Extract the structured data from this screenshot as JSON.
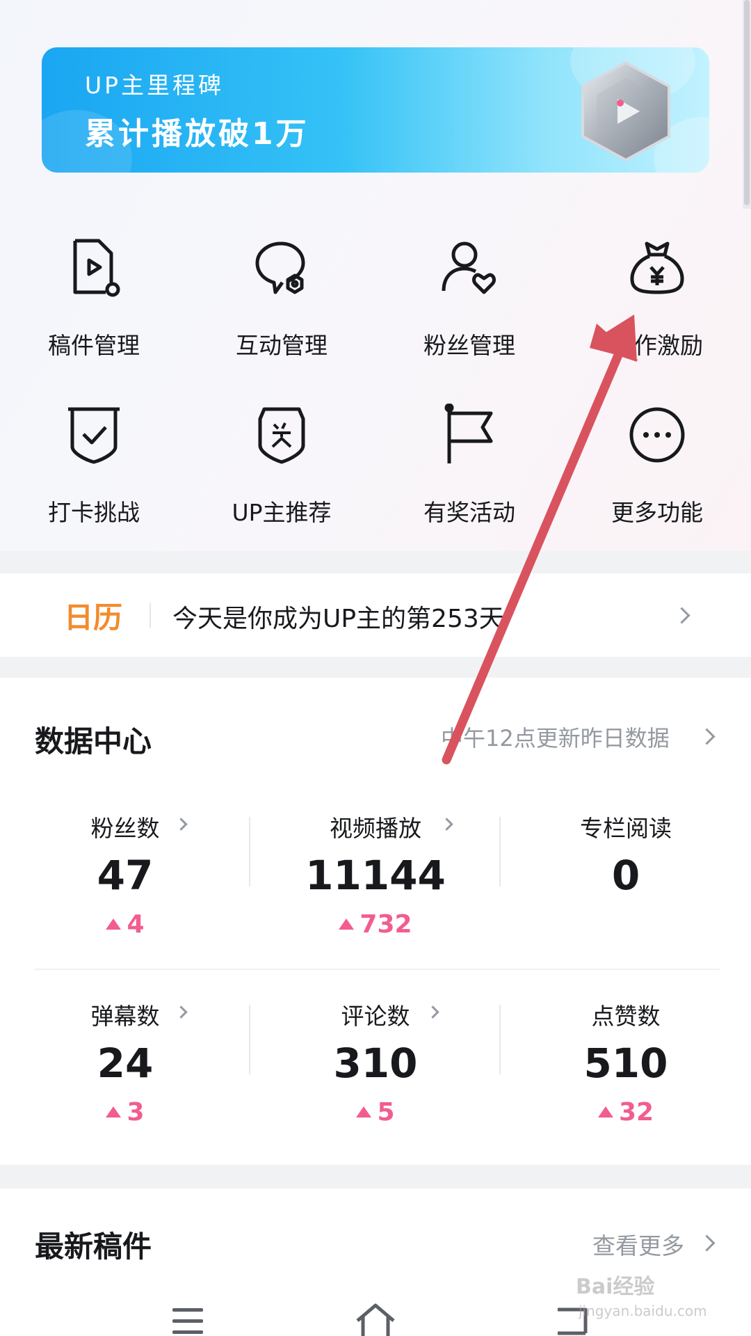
{
  "banner": {
    "subtitle": "UP主里程碑",
    "title": "累计播放破1万"
  },
  "tools": [
    {
      "label": "稿件管理",
      "icon": "manuscript-icon"
    },
    {
      "label": "互动管理",
      "icon": "interaction-icon"
    },
    {
      "label": "粉丝管理",
      "icon": "fans-icon"
    },
    {
      "label": "创作激励",
      "icon": "money-bag-icon"
    },
    {
      "label": "打卡挑战",
      "icon": "checkin-shield-icon"
    },
    {
      "label": "UP主推荐",
      "icon": "award-badge-icon"
    },
    {
      "label": "有奖活动",
      "icon": "flag-icon"
    },
    {
      "label": "更多功能",
      "icon": "more-icon"
    }
  ],
  "calendar": {
    "tag": "日历",
    "text": "今天是你成为UP主的第253天"
  },
  "data_center": {
    "title": "数据中心",
    "note": "中午12点更新昨日数据",
    "stats": [
      {
        "label": "粉丝数",
        "value": "47",
        "delta": "4"
      },
      {
        "label": "视频播放",
        "value": "11144",
        "delta": "732"
      },
      {
        "label": "专栏阅读",
        "value": "0",
        "delta": ""
      },
      {
        "label": "弹幕数",
        "value": "24",
        "delta": "3"
      },
      {
        "label": "评论数",
        "value": "310",
        "delta": "5"
      },
      {
        "label": "点赞数",
        "value": "510",
        "delta": "32"
      }
    ]
  },
  "latest": {
    "title": "最新稿件",
    "more": "查看更多"
  },
  "watermark": {
    "brand": "Bai经验",
    "url": "jingyan.baidu.com"
  },
  "colors": {
    "accent_pink": "#f25d8e",
    "calendar_orange": "#f28b2c",
    "annotation_arrow": "#d9535f"
  }
}
